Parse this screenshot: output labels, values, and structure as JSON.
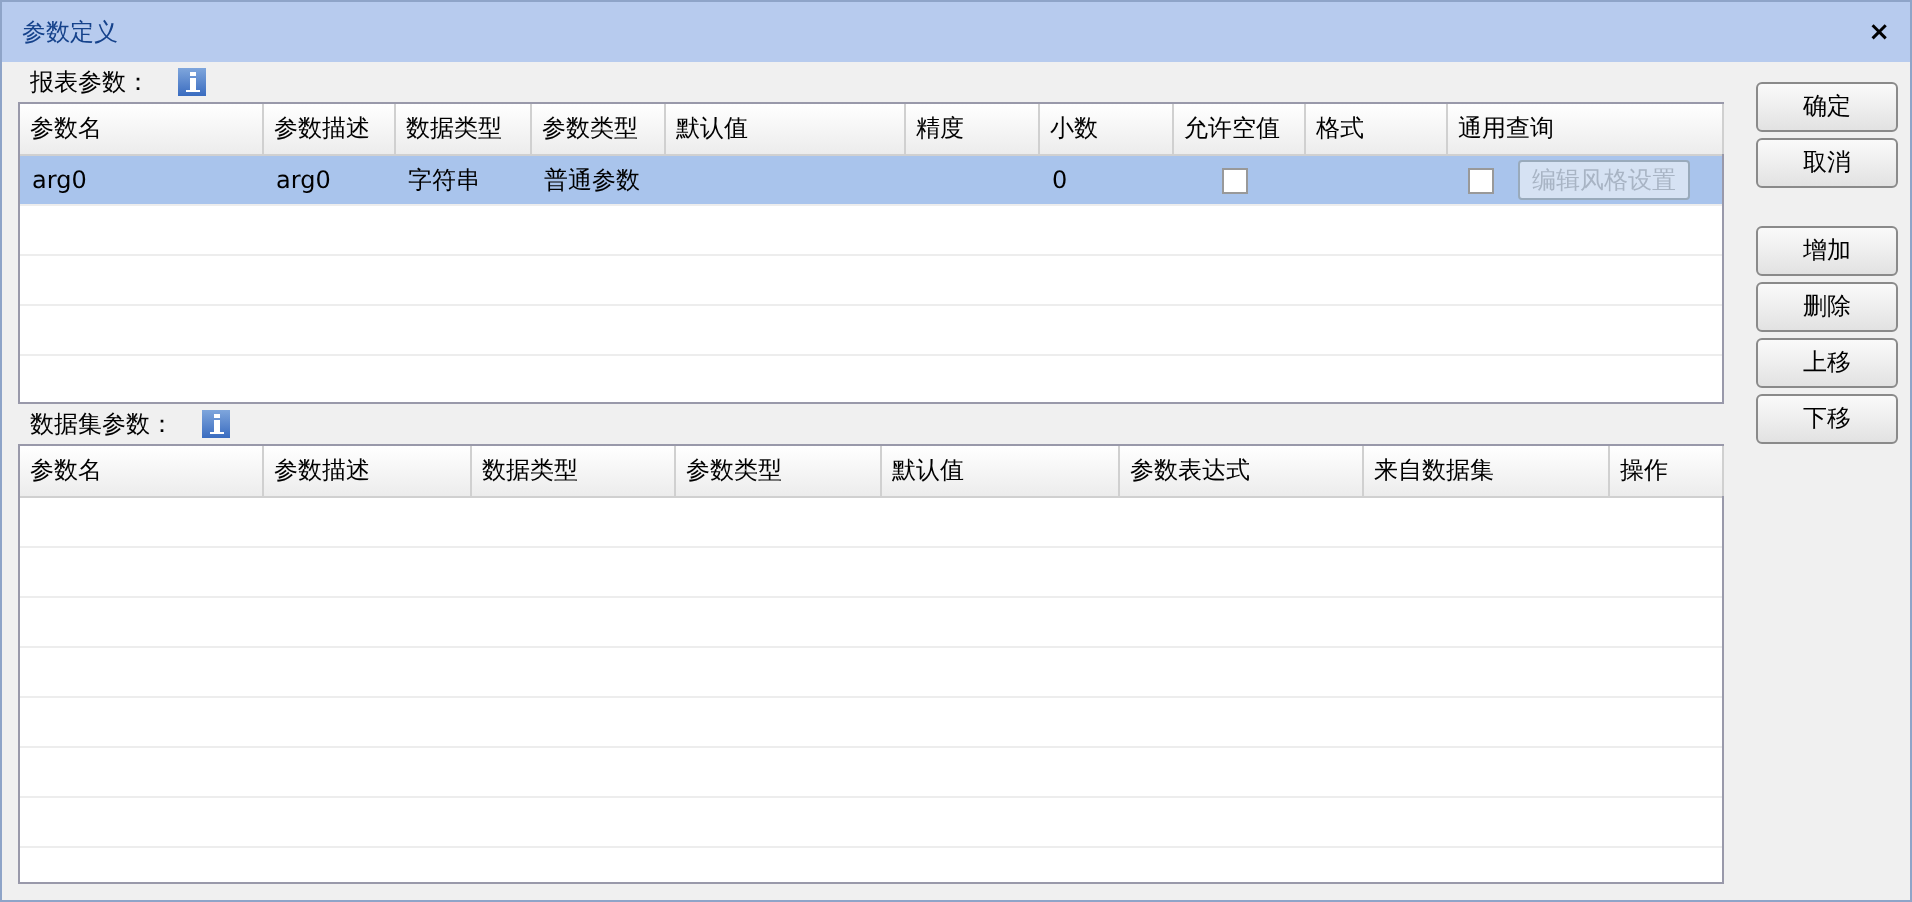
{
  "window": {
    "title": "参数定义",
    "close": "×"
  },
  "report_params": {
    "label": "报表参数：",
    "columns": [
      "参数名",
      "参数描述",
      "数据类型",
      "参数类型",
      "默认值",
      "精度",
      "小数",
      "允许空值",
      "格式",
      "通用查询"
    ],
    "rows": [
      {
        "selected": true,
        "cells": [
          {
            "kind": "text",
            "text": "arg0"
          },
          {
            "kind": "text",
            "text": "arg0"
          },
          {
            "kind": "text",
            "text": "字符串"
          },
          {
            "kind": "text",
            "text": "普通参数"
          },
          {
            "kind": "empty"
          },
          {
            "kind": "empty"
          },
          {
            "kind": "text",
            "text": "0"
          },
          {
            "kind": "checkbox",
            "checked": false
          },
          {
            "kind": "empty"
          },
          {
            "kind": "query",
            "checked": false,
            "button": {
              "label": "编辑风格设置",
              "disabled": true
            }
          }
        ]
      }
    ]
  },
  "dataset_params": {
    "label": "数据集参数：",
    "columns": [
      "参数名",
      "参数描述",
      "数据类型",
      "参数类型",
      "默认值",
      "参数表达式",
      "来自数据集",
      "操作"
    ]
  },
  "buttons": [
    {
      "label": "确定"
    },
    {
      "label": "取消"
    },
    {
      "label": "增加"
    },
    {
      "label": "删除"
    },
    {
      "label": "上移"
    },
    {
      "label": "下移"
    }
  ]
}
